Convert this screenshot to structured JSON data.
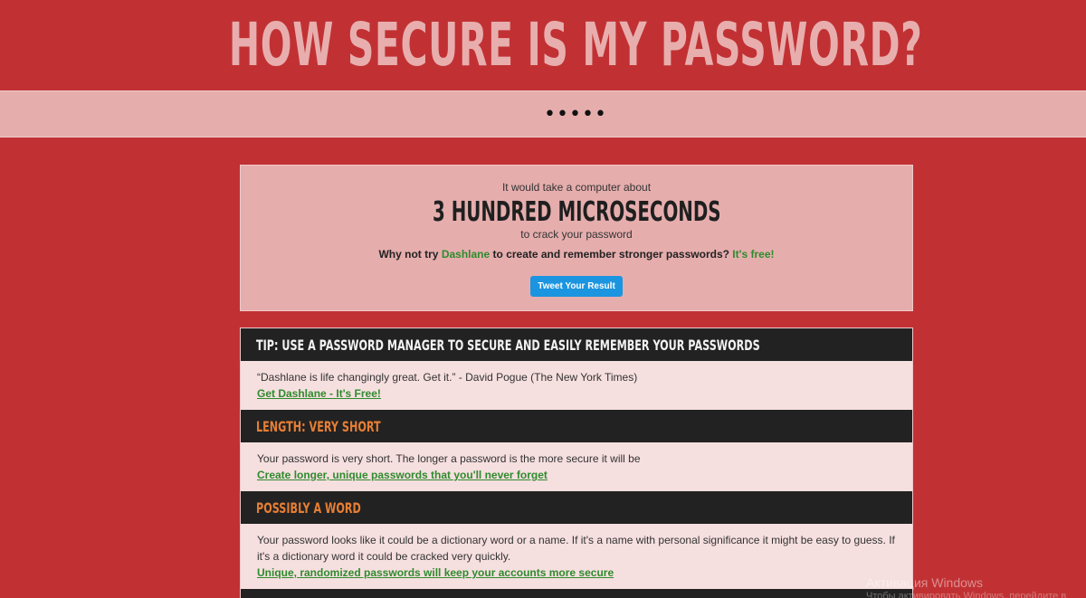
{
  "header": {
    "title": "HOW SECURE IS MY PASSWORD?"
  },
  "password_field": {
    "value": "•••••"
  },
  "result": {
    "pre_text": "It would take a computer about",
    "time": "3 HUNDRED MICROSECONDS",
    "post_text": "to crack your password",
    "why_prefix": "Why not try",
    "dashlane_link": "Dashlane",
    "why_middle": "to create and remember stronger passwords?",
    "free_link": "It's free!",
    "tweet_button": "Tweet Your Result"
  },
  "sections": [
    {
      "heading": "TIP: USE A PASSWORD MANAGER TO SECURE AND EASILY REMEMBER YOUR PASSWORDS",
      "heading_color": "#f2f2f2",
      "body": "“Dashlane is life changingly great. Get it.” - David Pogue (The New York Times)",
      "link": "Get Dashlane - It's Free!"
    },
    {
      "heading": "LENGTH: VERY SHORT",
      "heading_color": "#e67e34",
      "body": "Your password is very short. The longer a password is the more secure it will be",
      "link": "Create longer, unique passwords that you'll never forget"
    },
    {
      "heading": "POSSIBLY A WORD",
      "heading_color": "#e67e34",
      "body": "Your password looks like it could be a dictionary word or a name. If it's a name with personal significance it might be easy to guess. If it's a dictionary word it could be cracked very quickly.",
      "link": "Unique, randomized passwords will keep your accounts more secure"
    }
  ],
  "watermark": {
    "line1": "Активация Windows",
    "line2": "Чтобы активировать Windows, перейдите в"
  },
  "colors": {
    "background": "#c13133",
    "accent_pink": "#e6adad",
    "green_link": "#2e8b2e",
    "tweet_blue": "#1b95e0",
    "orange": "#e67e34"
  }
}
